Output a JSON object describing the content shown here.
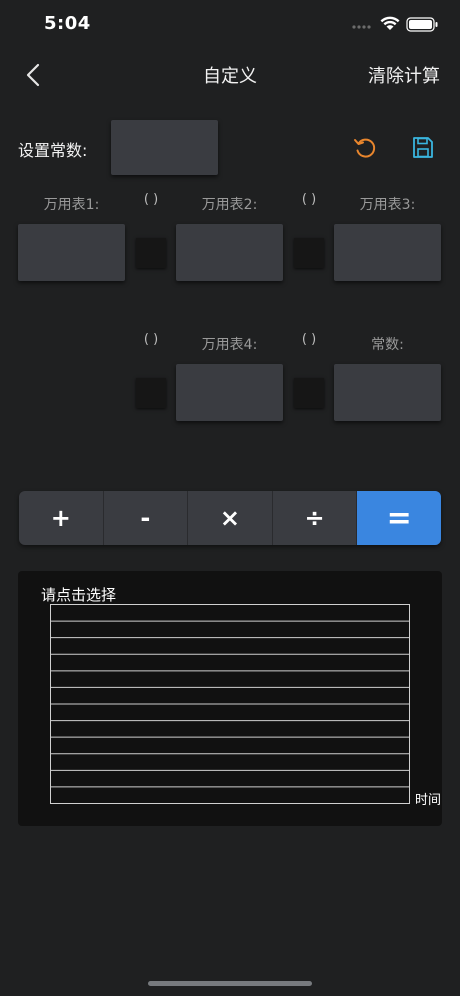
{
  "status": {
    "time": "5:04"
  },
  "nav": {
    "title": "自定义",
    "right_action": "清除计算"
  },
  "constant": {
    "label": "设置常数:"
  },
  "meters": {
    "row1": [
      {
        "label": "万用表1:"
      },
      {
        "label": "万用表2:"
      },
      {
        "label": "万用表3:"
      }
    ],
    "row2": [
      {
        "label": "万用表4:"
      },
      {
        "label": "常数:"
      }
    ],
    "paren_text": "(    )"
  },
  "operators": [
    "+",
    "-",
    "×",
    "÷",
    "="
  ],
  "active_operator_index": 4,
  "chart": {
    "title": "请点击选择",
    "xlabel": "时间"
  },
  "colors": {
    "background": "#1f2021",
    "accent": "#3a86e0",
    "reset_icon": "#e9862d",
    "save_icon": "#3ab6e0"
  },
  "icons": {
    "back": "chevron-left-icon",
    "reset": "undo-icon",
    "save": "floppy-disk-icon"
  }
}
